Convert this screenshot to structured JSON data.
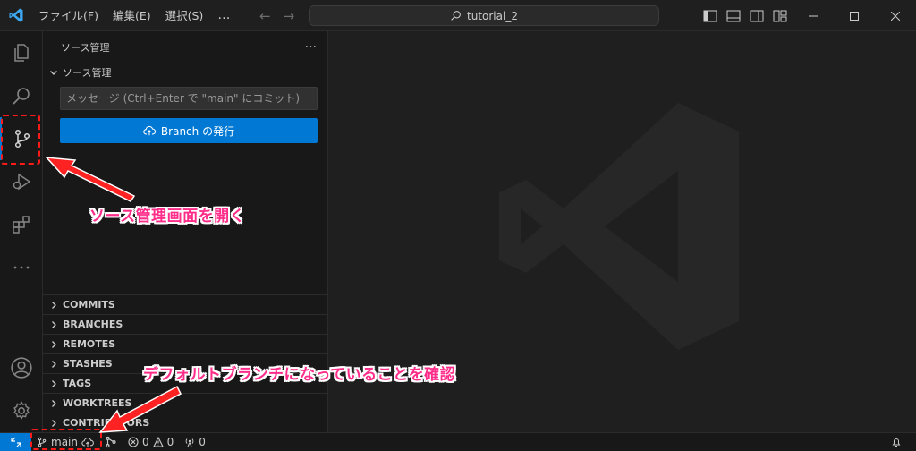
{
  "titlebar": {
    "menus": [
      "ファイル(F)",
      "編集(E)",
      "選択(S)"
    ],
    "more": "…",
    "search_text": "tutorial_2"
  },
  "activitybar": {
    "items": [
      "explorer-icon",
      "search-icon",
      "source-control-icon",
      "run-debug-icon",
      "extensions-icon",
      "more-icon"
    ],
    "bottom": [
      "accounts-icon",
      "manage-gear-icon"
    ],
    "active": "source-control-icon"
  },
  "sidebar": {
    "title": "ソース管理",
    "more": "···",
    "section_title": "ソース管理",
    "commit_placeholder": "メッセージ (Ctrl+Enter で \"main\" にコミット)",
    "publish_label": "Branch の発行",
    "sections": [
      "COMMITS",
      "BRANCHES",
      "REMOTES",
      "STASHES",
      "TAGS",
      "WORKTREES",
      "CONTRIBUTORS"
    ]
  },
  "statusbar": {
    "branch": "main",
    "errors": "0",
    "warnings": "0",
    "ports": "0"
  },
  "annotations": {
    "open_scm": "ソース管理画面を開く",
    "check_branch": "デフォルトブランチになっていることを確認"
  },
  "colors": {
    "accent": "#0078d4",
    "annotation_text": "#ff2d8a",
    "annotation_box": "#ff1a1a"
  }
}
